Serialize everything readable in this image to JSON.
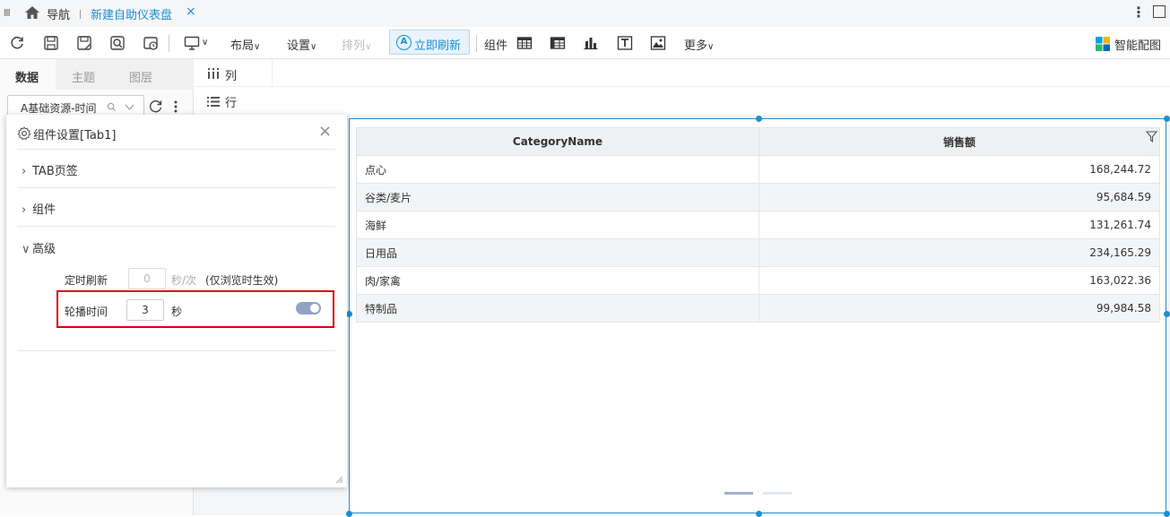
{
  "tabbar": {
    "menu_icon": "III",
    "nav_label": "导航",
    "active_tab": "新建自助仪表盘",
    "close_symbol": "×",
    "kebab_symbol": "⋮"
  },
  "toolbar": {
    "layout_label": "布局",
    "settings_label": "设置",
    "arrange_label": "排列",
    "refresh_label": "立即刷新",
    "component_label": "组件",
    "more_label": "更多",
    "smart_color_label": "智能配图",
    "chevron": "∨"
  },
  "left_panel": {
    "tabs": [
      "数据",
      "主题",
      "图层"
    ],
    "active_tab": 0,
    "datasource_value": "A基础资源-时间"
  },
  "fields": {
    "column_label": "列",
    "row_label": "行"
  },
  "table": {
    "headers": [
      "CategoryName",
      "销售额"
    ],
    "rows": [
      [
        "点心",
        "168,244.72"
      ],
      [
        "谷类/麦片",
        "95,684.59"
      ],
      [
        "海鲜",
        "131,261.74"
      ],
      [
        "日用品",
        "234,165.29"
      ],
      [
        "肉/家禽",
        "163,022.36"
      ],
      [
        "特制品",
        "99,984.58"
      ]
    ]
  },
  "pagination": {
    "pages": 2,
    "current": 1
  },
  "settings_panel": {
    "title": "组件设置[Tab1]",
    "sections": [
      "TAB页签",
      "组件",
      "高级"
    ],
    "refresh_label": "定时刷新",
    "refresh_value": "0",
    "refresh_unit": "秒/次",
    "refresh_note": "(仅浏览时生效)",
    "carousel_label": "轮播时间",
    "carousel_value": "3",
    "carousel_unit": "秒",
    "carousel_enabled": true
  },
  "colors": {
    "accent": "#1a8fd3",
    "highlight": "#d9000e",
    "toggle_on": "#8fa3c4"
  }
}
